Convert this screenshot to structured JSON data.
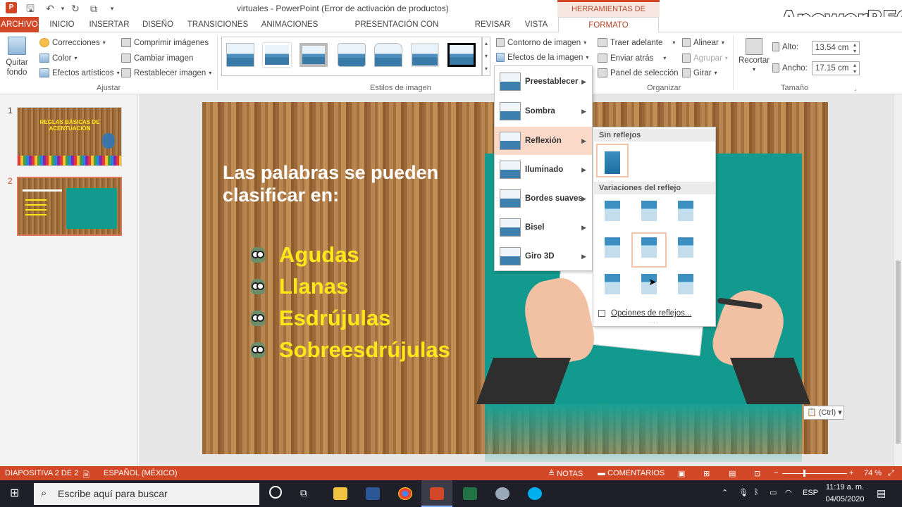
{
  "window": {
    "title": "virtuales - PowerPoint (Error de activación de productos)",
    "context_header": "HERRAMIENTAS DE IMAGEN",
    "watermark": "ApowerREC"
  },
  "tabs": [
    "ARCHIVO",
    "INICIO",
    "INSERTAR",
    "DISEÑO",
    "TRANSICIONES",
    "ANIMACIONES",
    "PRESENTACIÓN CON DIAPOSITIVAS",
    "REVISAR",
    "VISTA",
    "FORMATO"
  ],
  "ribbon": {
    "quitar_fondo": "Quitar fondo",
    "correcciones": "Correcciones",
    "color": "Color",
    "efectos_artisticos": "Efectos artísticos",
    "comprimir": "Comprimir imágenes",
    "cambiar": "Cambiar imagen",
    "restablecer": "Restablecer imagen",
    "group_ajustar": "Ajustar",
    "group_estilos": "Estilos de imagen",
    "contorno": "Contorno de imagen",
    "efectos": "Efectos de la imagen",
    "traer": "Traer adelante",
    "enviar": "Enviar atrás",
    "panel": "Panel de selección",
    "alinear": "Alinear",
    "agrupar": "Agrupar",
    "girar": "Girar",
    "group_organizar": "Organizar",
    "recortar": "Recortar",
    "alto_label": "Alto:",
    "alto_value": "13.54 cm",
    "ancho_label": "Ancho:",
    "ancho_value": "17.15 cm",
    "group_tamano": "Tamaño"
  },
  "thumbnails": [
    {
      "num": "1",
      "title": "REGLAS BÁSICAS DE ACENTUACIÓN"
    },
    {
      "num": "2"
    }
  ],
  "slide": {
    "title": "Las palabras se pueden clasificar en:",
    "bullets": [
      "Agudas",
      "Llanas",
      "Esdrújulas",
      "Sobreesdrújulas"
    ],
    "paste_tag": "(Ctrl)"
  },
  "effects_menu": {
    "items": [
      "Preestablecer",
      "Sombra",
      "Reflexión",
      "Iluminado",
      "Bordes suaves",
      "Bisel",
      "Giro 3D"
    ],
    "highlighted": "Reflexión"
  },
  "reflection_menu": {
    "no_reflection": "Sin reflejos",
    "variations": "Variaciones del reflejo",
    "options": "Opciones de reflejos..."
  },
  "status": {
    "slide": "DIAPOSITIVA 2 DE 2",
    "language": "ESPAÑOL (MÉXICO)",
    "notes": "NOTAS",
    "comments": "COMENTARIOS",
    "zoom": "74 %"
  },
  "taskbar": {
    "search_placeholder": "Escribe aquí para buscar",
    "lang": "ESP",
    "time": "11:19 a. m.",
    "date": "04/05/2020"
  },
  "colors": {
    "accent": "#d24726",
    "menu_highlight": "#fbd9c9",
    "bullet_text": "#ffe81a"
  }
}
